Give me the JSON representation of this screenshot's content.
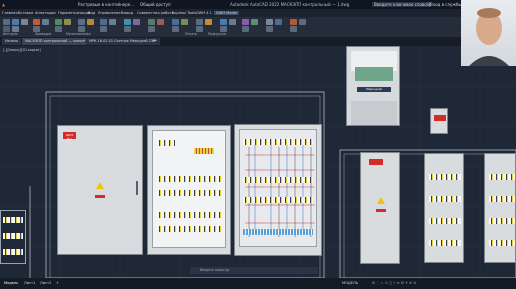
{
  "window": {
    "title": "Autodesk AutoCAD 2022   МАСКЭПП контрольный — 1.dwg",
    "tab_left": "Растровые в контейнере...",
    "share": "Общий доступ",
    "search_placeholder": "Введите ключевое слово/фразу",
    "user": "Вход в службы"
  },
  "menu": {
    "items": [
      "Главная",
      "Вставка",
      "Аннотации",
      "Параметризация",
      "Вид",
      "Управление",
      "Вывод",
      "Совместная работа",
      "Express Tools",
      "DWH 4.1",
      "DWH Model"
    ]
  },
  "ribbon": {
    "panels": [
      "Рисование",
      "Редактирование",
      "Аннотации",
      "Слои",
      "Блок",
      "Свойства",
      "Группы",
      "Утилиты",
      "Буфер обмена",
      "Вид"
    ],
    "panel_row": [
      "Инструм.",
      "Проводка",
      "Мультикнопки",
      "Печать",
      "Подгрузка"
    ]
  },
  "document_tabs": [
    {
      "label": "Начало",
      "active": false
    },
    {
      "label": "МАСКЭПП контрольный — копия*",
      "active": true
    },
    {
      "label": "МРК-16-02-01 Счетчик Меркурий 230*",
      "active": false
    }
  ],
  "view_label": "[-][Сверху][2D-каркас]",
  "command_line": {
    "placeholder": "Введите команду"
  },
  "status": {
    "model_tab": "Модель",
    "layout1": "Лист1",
    "layout2": "Лист2",
    "add_icon": "plus-icon",
    "model_label": "МОДЕЛЬ"
  },
  "drawing": {
    "cabinet_tag": "ЩУЭ №1",
    "meter_label": "Меркурий",
    "warning_symbol": "lightning-warning-icon"
  },
  "colors": {
    "canvas": "#1f2836",
    "ribbon": "#252d3b",
    "accent_red": "#d42a2a",
    "warning_yellow": "#f5c400"
  }
}
